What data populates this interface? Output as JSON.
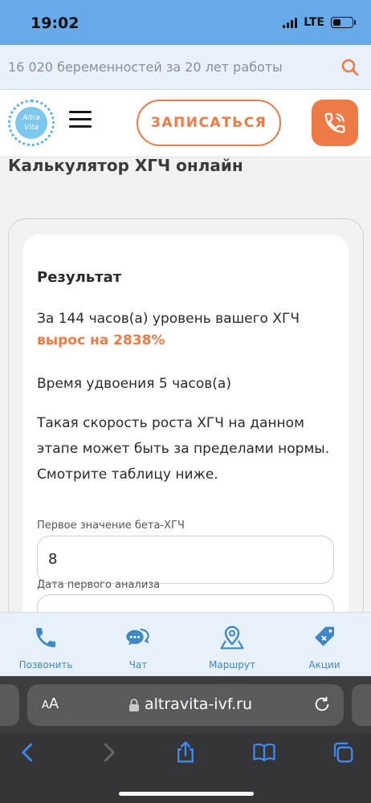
{
  "status_bar": {
    "time": "19:02",
    "network": "LTE"
  },
  "search": {
    "text": "16 020 беременностей за 20 лет работы"
  },
  "header": {
    "logo_text_1": "Altra",
    "logo_text_2": "Vita",
    "signup_label": "ЗАПИСАТЬСЯ"
  },
  "page": {
    "title": "Калькулятор ХГЧ онлайн",
    "result_heading": "Результат",
    "result_line": "За 144 часов(а) уровень вашего ХГЧ",
    "growth_text": "вырос на 2838%",
    "doubling_text": "Время удвоения 5 часов(а)",
    "warning_text": "Такая скорость роста ХГЧ на данном этапе может быть за пределами нормы. Смотрите таблицу ниже.",
    "field1_label": "Первое значение бета-ХГЧ",
    "field1_value": "8",
    "field2_label": "Дата первого анализа",
    "field2_value": ""
  },
  "bottom_nav": [
    {
      "label": "Позвонить",
      "icon": "phone-icon"
    },
    {
      "label": "Чат",
      "icon": "chat-icon"
    },
    {
      "label": "Маршрут",
      "icon": "map-pin-icon"
    },
    {
      "label": "Акции",
      "icon": "tag-icon"
    }
  ],
  "browser": {
    "aa_label_small": "A",
    "aa_label": "A",
    "url": "altravita-ivf.ru"
  },
  "colors": {
    "accent": "#ee7a45",
    "primary_blue": "#3f88c7",
    "status_bar": "#66aae9"
  }
}
